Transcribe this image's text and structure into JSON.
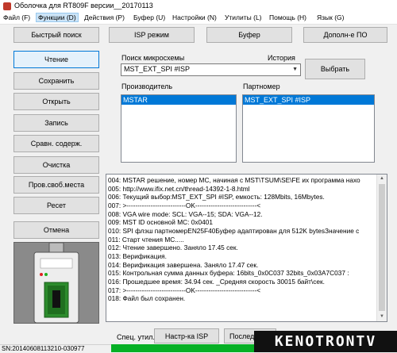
{
  "window": {
    "title": "Оболочка для RT809F версии__20170113"
  },
  "menu": [
    "Файл (F)",
    "Функции (D)",
    "Действия (P)",
    "Буфер (U)",
    "Настройки (N)",
    "Утилиты (L)",
    "Помощь (H)",
    "Язык (G)"
  ],
  "toolbar": {
    "quick_search": "Быстрый поиск",
    "isp_mode": "ISP режим",
    "buffer": "Буфер",
    "extra": "Дополн-е ПО"
  },
  "sidebar": [
    "Чтение",
    "Сохранить",
    "Открыть",
    "Запись",
    "Сравн. содерж.",
    "Очистка",
    "Пров.своб.места",
    "Ресет"
  ],
  "cancel": "Отмена",
  "search": {
    "label": "Поиск микросхемы",
    "history_label": "История",
    "value": "MST_EXT_SPI #ISP",
    "select_button": "Выбрать"
  },
  "manufacturer": {
    "label": "Производитель",
    "selected": "MSTAR"
  },
  "partnumber": {
    "label": "Партномер",
    "selected": "MST_EXT_SPI #ISP"
  },
  "log": [
    "004:  MSTAR решение, номер МС, начиная с MST\\TSUM\\SE\\FE их программа нахо",
    "005:  http://www.ifix.net.cn/thread-14392-1-8.html",
    "006:  Текущий выбор:MST_EXT_SPI #ISP, емкость: 128Mbits, 16Mbytes.",
    "007:  >---------------------------OK----------------------------<",
    "008:  VGA wire mode: SCL: VGA--15; SDA: VGA--12.",
    "009:  MST ID основной МС: 0x0401",
    "010:  SPI флэш партномерEN25F40Буфер адаптирован для 512K bytesЗначение с",
    "011:  Старт чтения МС.....",
    "012:  Чтение завершено. Заняло 17.45 сек.",
    "013:  Верификация.",
    "014:  Верификация завершена. Заняло 17.47 сек.",
    "015:  Контрольная сумма данных буфера: 16bits_0x0C037  32bits_0x03A7C037 :",
    "016:  Прошедшее время: 34.94 сек. _Средняя скорость 30015 байт\\сек.",
    "017:  >---------------------------OK----------------------------<",
    "018:  Файл был сохранен."
  ],
  "bottom": {
    "special_label": "Спец. утил.",
    "isp_settings": "Настр-ка ISP",
    "sequence": "Послед-е"
  },
  "status": {
    "serial": "SN:20140608113210-030977"
  },
  "watermark": "KENOTRONTV",
  "colors": {
    "selection": "#0078d7",
    "progress": "#06b025"
  }
}
